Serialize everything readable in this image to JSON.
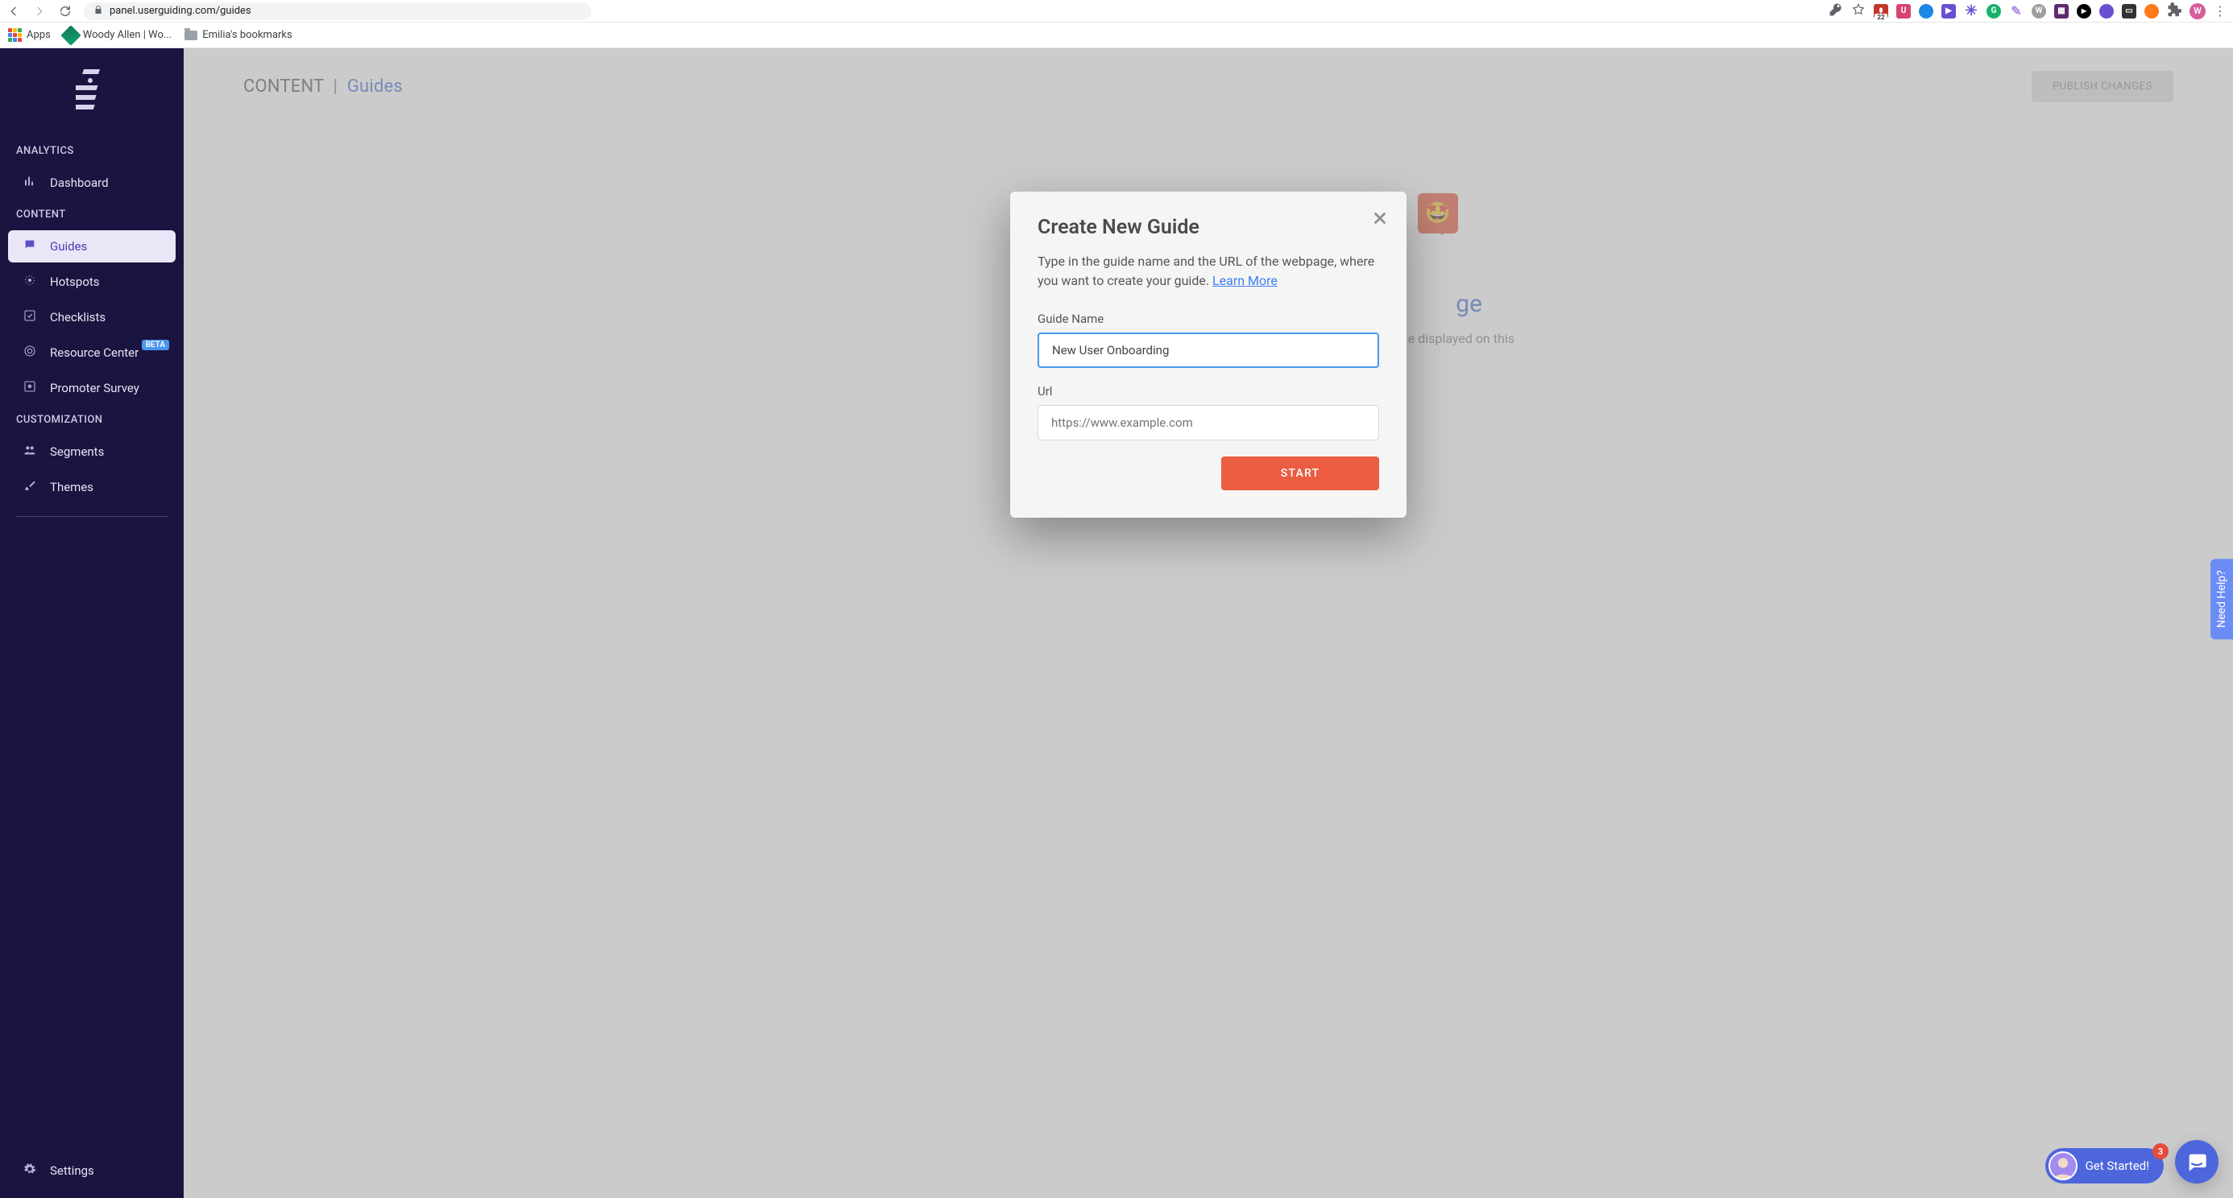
{
  "browser": {
    "url": "panel.userguiding.com/guides",
    "bookmarks": {
      "apps": "Apps",
      "woody": "Woody Allen | Wo...",
      "folder": "Emilia's bookmarks"
    },
    "avatar_initial": "W",
    "ext_lp_count": "22"
  },
  "sidebar": {
    "sections": {
      "analytics": "ANALYTICS",
      "content": "CONTENT",
      "customization": "CUSTOMIZATION"
    },
    "items": {
      "dashboard": "Dashboard",
      "guides": "Guides",
      "hotspots": "Hotspots",
      "checklists": "Checklists",
      "resource_center": "Resource Center",
      "resource_center_badge": "BETA",
      "promoter_survey": "Promoter Survey",
      "segments": "Segments",
      "themes": "Themes",
      "settings": "Settings"
    }
  },
  "header": {
    "root": "CONTENT",
    "sep": "|",
    "current": "Guides",
    "publish": "PUBLISH CHANGES"
  },
  "background_card": {
    "title_suffix": "ge",
    "subtitle_suffix": "e displayed on this"
  },
  "modal": {
    "title": "Create New Guide",
    "description": "Type in the guide name and the URL of the webpage, where you want to create your guide. ",
    "learn_more": "Learn More",
    "guide_name_label": "Guide Name",
    "guide_name_value": "New User Onboarding",
    "url_label": "Url",
    "url_placeholder": "https://www.example.com",
    "start": "START"
  },
  "widgets": {
    "help_tab": "Need Help?",
    "get_started": "Get Started!",
    "get_started_count": "3"
  }
}
